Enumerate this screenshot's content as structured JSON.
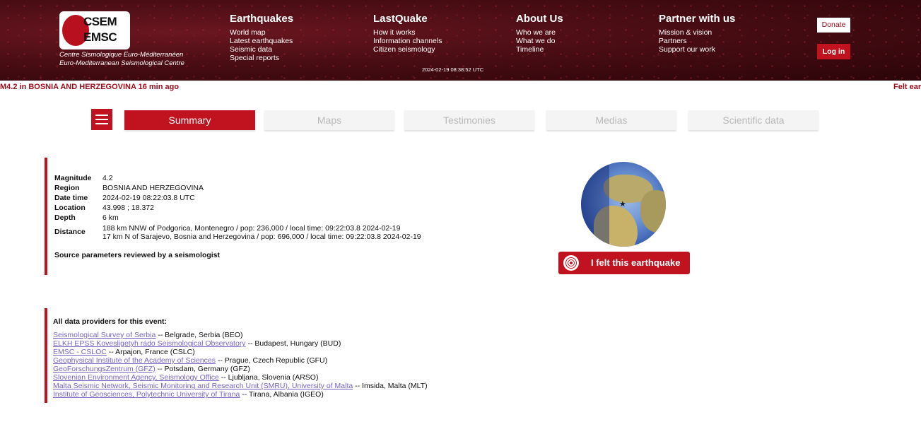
{
  "brand": {
    "logo_top": "CSEM",
    "logo_bottom": "EMSC",
    "tagline_fr": "Centre Sismologique Euro-Méditerranéen",
    "tagline_en": "Euro-Mediterranean Seismological Centre"
  },
  "nav": [
    {
      "title": "Earthquakes",
      "links": [
        "World map",
        "Latest earthquakes",
        "Seismic data",
        "Special reports"
      ]
    },
    {
      "title": "LastQuake",
      "links": [
        "How it works",
        "Information channels",
        "Citizen seismology"
      ]
    },
    {
      "title": "About Us",
      "links": [
        "Who we are",
        "What we do",
        "Timeline"
      ]
    },
    {
      "title": "Partner with us",
      "links": [
        "Mission & vision",
        "Partners",
        "Support our work"
      ]
    }
  ],
  "clock": "2024-02-19 08:38:52 UTC",
  "buttons": {
    "donate": "Donate",
    "login": "Log in"
  },
  "ticker": {
    "left": "M4.2 in BOSNIA AND HERZEGOVINA 16 min ago",
    "right": "Felt ear"
  },
  "tabs": [
    "Summary",
    "Maps",
    "Testimonies",
    "Medias",
    "Scientific data"
  ],
  "summary": {
    "magnitude_label": "Magnitude",
    "magnitude": "4.2",
    "region_label": "Region",
    "region": "BOSNIA AND HERZEGOVINA",
    "datetime_label": "Date time",
    "datetime": "2024-02-19 08:22:03.8 UTC",
    "location_label": "Location",
    "location": "43.998 ; 18.372",
    "depth_label": "Depth",
    "depth": "6 km",
    "distance_label": "Distance",
    "distance_1": "188 km NNW of Podgorica, Montenegro / pop: 236,000 / local time: 09:22:03.8 2024-02-19",
    "distance_2": "17 km N of Sarajevo, Bosnia and Herzegovina / pop: 696,000 / local time: 09:22:03.8 2024-02-19",
    "source": "Source parameters reviewed by a seismologist"
  },
  "felt_button": "I felt this earthquake",
  "providers": {
    "title": "All data providers for this event:",
    "items": [
      {
        "name": "Seismological Survey of Serbia",
        "rest": " -- Belgrade, Serbia (BEO)"
      },
      {
        "name": "ELKH EPSS Kovesligetyh rado Seismological Observatory",
        "rest": " -- Budapest, Hungary (BUD)"
      },
      {
        "name": "EMSC - CSLOC",
        "rest": " -- Arpajon, France (CSLC)"
      },
      {
        "name": "Geophysical Institute of the Academy of Sciences",
        "rest": " -- Prague, Czech Republic (GFU)"
      },
      {
        "name": "GeoForschungsZentrum (GFZ)",
        "rest": " -- Potsdam, Germany (GFZ)"
      },
      {
        "name": "Slovenian Environment Agency, Seismology Office",
        "rest": " -- Ljubljana, Slovenia (ARSO)"
      },
      {
        "name": "Malta Seismic Network, Seismic Monitoring and Research Unit (SMRU), University of Malta",
        "rest": " -- Imsida, Malta (MLT)"
      },
      {
        "name": "Institute of Geosciences, Polytechnic University of Tirana",
        "rest": " -- Tirana, Albania (IGEO)"
      }
    ]
  },
  "colors": {
    "accent": "#c0121f",
    "header_bg": "#4a0d14",
    "link": "#7a63c7"
  }
}
